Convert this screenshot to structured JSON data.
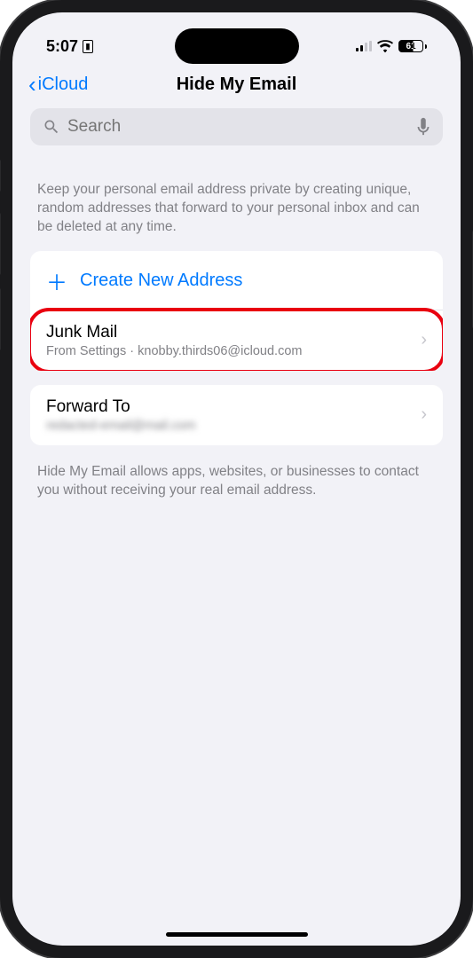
{
  "statusBar": {
    "time": "5:07",
    "battery": "61"
  },
  "nav": {
    "back": "iCloud",
    "title": "Hide My Email"
  },
  "search": {
    "placeholder": "Search"
  },
  "intro": "Keep your personal email address private by creating unique, random addresses that forward to your personal inbox and can be deleted at any time.",
  "createAction": "Create New Address",
  "aliases": [
    {
      "title": "Junk Mail",
      "subtitle": "From Settings · knobby.thirds06@icloud.com"
    }
  ],
  "forward": {
    "title": "Forward To",
    "subtitle": "redacted-email@mail.com"
  },
  "footer": "Hide My Email allows apps, websites, or businesses to contact you without receiving your real email address."
}
